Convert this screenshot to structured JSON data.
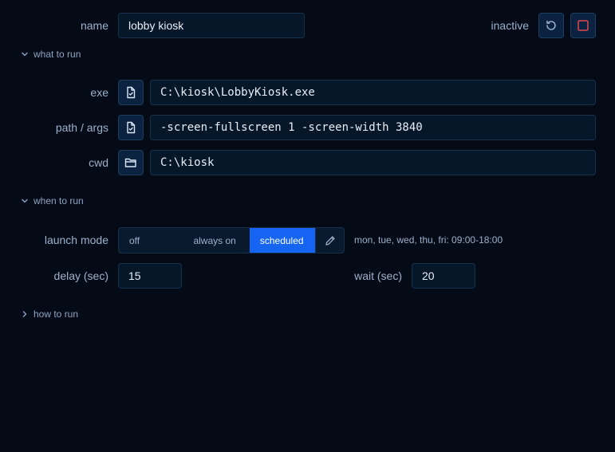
{
  "name": {
    "label": "name",
    "value": "lobby kiosk",
    "status": "inactive"
  },
  "sections": {
    "what": "what to run",
    "when": "when to run",
    "how": "how to run"
  },
  "what": {
    "exe_label": "exe",
    "exe_value": "C:\\kiosk\\LobbyKiosk.exe",
    "args_label": "path / args",
    "args_value": "-screen-fullscreen 1 -screen-width 3840",
    "cwd_label": "cwd",
    "cwd_value": "C:\\kiosk"
  },
  "when": {
    "mode_label": "launch mode",
    "modes": [
      "off",
      "always on",
      "scheduled"
    ],
    "selected_mode": "scheduled",
    "schedule": "mon, tue, wed, thu, fri: 09:00-18:00",
    "delay_label": "delay (sec)",
    "delay_value": "15",
    "wait_label": "wait (sec)",
    "wait_value": "20"
  },
  "icons": {
    "reset": "reset-icon",
    "stop": "stop-icon",
    "file": "file-icon",
    "folder": "folder-icon",
    "pencil": "pencil-icon",
    "chevron_down": "chevron-down-icon",
    "chevron_right": "chevron-right-icon"
  },
  "colors": {
    "background": "#040b17",
    "accent": "#1565f2",
    "stop": "#e0474c"
  }
}
